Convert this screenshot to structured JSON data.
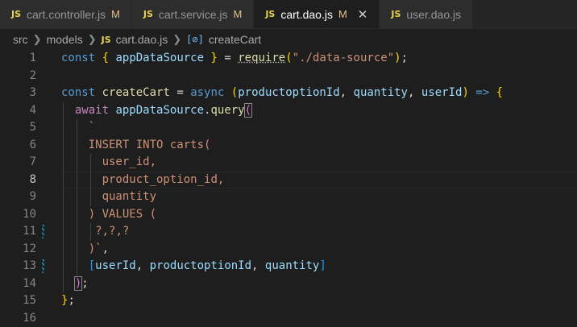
{
  "tabs": [
    {
      "icon": "JS",
      "label": "cart.controller.js",
      "status": "M"
    },
    {
      "icon": "JS",
      "label": "cart.service.js",
      "status": "M"
    },
    {
      "icon": "JS",
      "label": "cart.dao.js",
      "status": "M",
      "close": "✕"
    },
    {
      "icon": "JS",
      "label": "user.dao.js"
    }
  ],
  "breadcrumb": {
    "folder1": "src",
    "folder2": "models",
    "file_icon": "JS",
    "file": "cart.dao.js",
    "symbol": "createCart"
  },
  "editor": {
    "line_numbers": [
      "1",
      "2",
      "3",
      "4",
      "5",
      "6",
      "7",
      "8",
      "9",
      "10",
      "11",
      "12",
      "13",
      "14",
      "15",
      "16"
    ],
    "active_line": "8",
    "code": {
      "l1": {
        "const": "const",
        "brace_open": "{",
        "ads": "appDataSource",
        "brace_close": "}",
        "eq": "=",
        "require": "require",
        "paren_open": "(",
        "path": "\"./data-source\"",
        "paren_close": ")",
        "semi": ";"
      },
      "l3": {
        "const": "const",
        "name": "createCart",
        "eq": "=",
        "async": "async",
        "paren_open": "(",
        "p1": "productoptionId",
        "c1": ",",
        "p2": "quantity",
        "c2": ",",
        "p3": "userId",
        "paren_close": ")",
        "arrow": "=>",
        "brace": "{"
      },
      "l4": {
        "await": "await",
        "ads": "appDataSource",
        "dot": ".",
        "query": "query",
        "paren": "("
      },
      "l5": "`",
      "l6": "INSERT INTO carts(",
      "l7": "user_id,",
      "l8": "product_option_id,",
      "l9": "quantity",
      "l10": ") VALUES (",
      "l11": "?,?,?",
      "l12": ")`",
      "l12_comma": ",",
      "l13": {
        "bracket_open": "[",
        "a": "userId",
        "c1": ",",
        "b": "productoptionId",
        "c2": ",",
        "c": "quantity",
        "bracket_close": "]"
      },
      "l14": {
        "paren": ")",
        "semi": ";"
      },
      "l15": {
        "brace": "}",
        "semi": ";"
      }
    }
  },
  "colors": {
    "keyword": "#569cd6",
    "control": "#c586c0",
    "variable": "#9cdcfe",
    "function": "#dcdcaa",
    "string": "#ce9178",
    "bracket_gold": "#ffd700",
    "bracket_orchid": "#da70d6",
    "bracket_blue": "#179fff"
  }
}
